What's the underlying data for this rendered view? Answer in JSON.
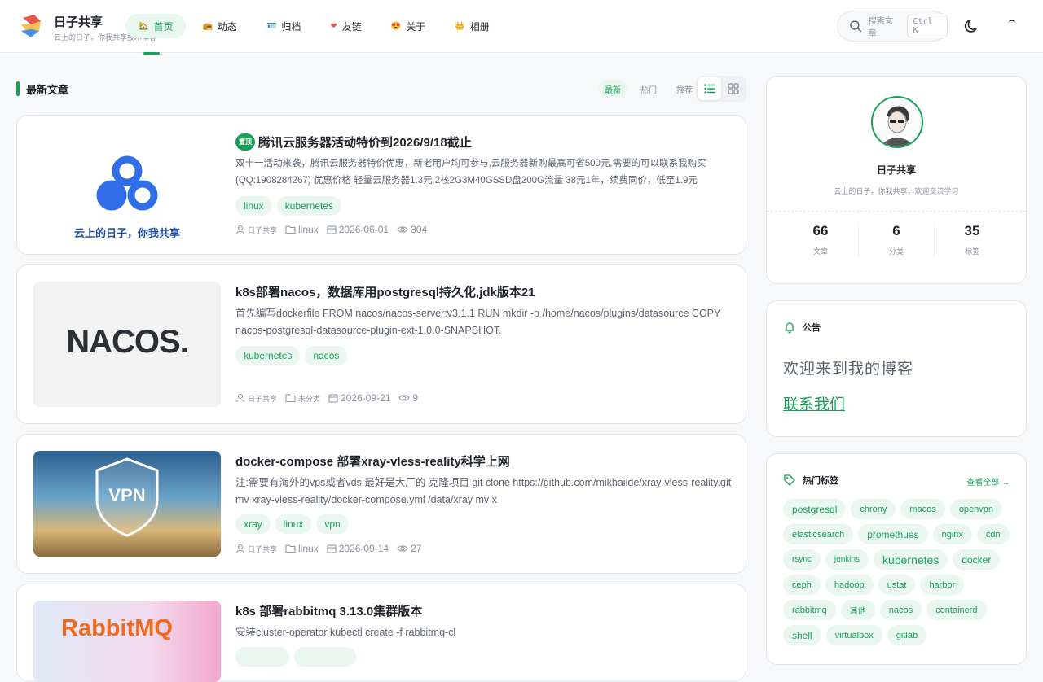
{
  "header": {
    "site_title": "日子共享",
    "site_subtitle": "云上的日子，你我共享技术博客",
    "nav": [
      {
        "icon": "🏡",
        "label": "首页",
        "active": true
      },
      {
        "icon": "📻",
        "label": "动态"
      },
      {
        "icon": "🪪",
        "label": "归档"
      },
      {
        "icon": "❤",
        "label": "友链"
      },
      {
        "icon": "😍",
        "label": "关于"
      },
      {
        "icon": "👑",
        "label": "相册"
      }
    ],
    "search_placeholder": "搜索文章",
    "search_shortcut": "Ctrl K"
  },
  "main": {
    "section_title": "最新文章",
    "sort_tabs": [
      "最新",
      "热门",
      "推荐"
    ],
    "posts": [
      {
        "pinned_label": "置顶",
        "title": "腾讯云服务器活动特价到2026/9/18截止",
        "excerpt": "双十一活动来袭，腾讯云服务器特价优惠，新老用户均可参与,云服务器新购最高可省500元,需要的可以联系我购买 (QQ:1908284267) 优惠价格 轻量云服务器1.3元 2核2G3M40GSSD盘200G流量 38元1年，续费同价，低至1.9元",
        "tags": [
          "linux",
          "kubernetes"
        ],
        "author": "日子共享",
        "category": "linux",
        "date": "2026-06-01",
        "views": "304",
        "thumb_text": "云上的日子，你我共享"
      },
      {
        "title": "k8s部署nacos，数据库用postgresql持久化,jdk版本21",
        "excerpt": "首先编写dockerfile FROM nacos/nacos-server:v3.1.1 RUN mkdir -p /home/nacos/plugins/datasource COPY nacos-postgresql-datasource-plugin-ext-1.0.0-SNAPSHOT.",
        "tags": [
          "kubernetes",
          "nacos"
        ],
        "author": "日子共享",
        "category": "未分类",
        "date": "2026-09-21",
        "views": "9",
        "thumb_text": "NACOS."
      },
      {
        "title": "docker-compose 部署xray-vless-reality科学上网",
        "excerpt": "注:需要有海外的vps或者vds,最好是大厂的 克隆项目 git clone https://github.com/mikhailde/xray-vless-reality.git mv xray-vless-reality/docker-compose.yml /data/xray mv x",
        "tags": [
          "xray",
          "linux",
          "vpn"
        ],
        "author": "日子共享",
        "category": "linux",
        "date": "2026-09-14",
        "views": "27",
        "thumb_text": "VPN"
      },
      {
        "title": "k8s 部署rabbitmq 3.13.0集群版本",
        "excerpt": "安装cluster-operator kubectl create -f rabbitmq-cl",
        "thumb_text": "RabbitMQ"
      }
    ]
  },
  "sidebar": {
    "author": {
      "name": "日子共享",
      "description": "云上的日子，你我共享，欢迎交流学习",
      "stats": [
        {
          "num": "66",
          "label": "文章"
        },
        {
          "num": "6",
          "label": "分类"
        },
        {
          "num": "35",
          "label": "标签"
        }
      ]
    },
    "notice": {
      "title": "公告",
      "text": "欢迎来到我的博客",
      "link": "联系我们"
    },
    "tags": {
      "title": "热门标签",
      "more": "查看全部 →",
      "items": [
        {
          "label": "postgresql",
          "size": 12
        },
        {
          "label": "chrony",
          "size": 11
        },
        {
          "label": "macos",
          "size": 11
        },
        {
          "label": "openvpn",
          "size": 11
        },
        {
          "label": "elasticsearch",
          "size": 11
        },
        {
          "label": "promethues",
          "size": 12
        },
        {
          "label": "nginx",
          "size": 11
        },
        {
          "label": "cdn",
          "size": 11
        },
        {
          "label": "rsync",
          "size": 10
        },
        {
          "label": "jenkins",
          "size": 10
        },
        {
          "label": "kubernetes",
          "size": 14
        },
        {
          "label": "docker",
          "size": 12
        },
        {
          "label": "ceph",
          "size": 11
        },
        {
          "label": "hadoop",
          "size": 11
        },
        {
          "label": "ustat",
          "size": 11
        },
        {
          "label": "harbor",
          "size": 11
        },
        {
          "label": "rabbitmq",
          "size": 11
        },
        {
          "label": "其他",
          "size": 10
        },
        {
          "label": "nacos",
          "size": 11
        },
        {
          "label": "containerd",
          "size": 11
        },
        {
          "label": "shell",
          "size": 12
        },
        {
          "label": "virtualbox",
          "size": 11
        },
        {
          "label": "gitlab",
          "size": 11
        }
      ]
    }
  }
}
